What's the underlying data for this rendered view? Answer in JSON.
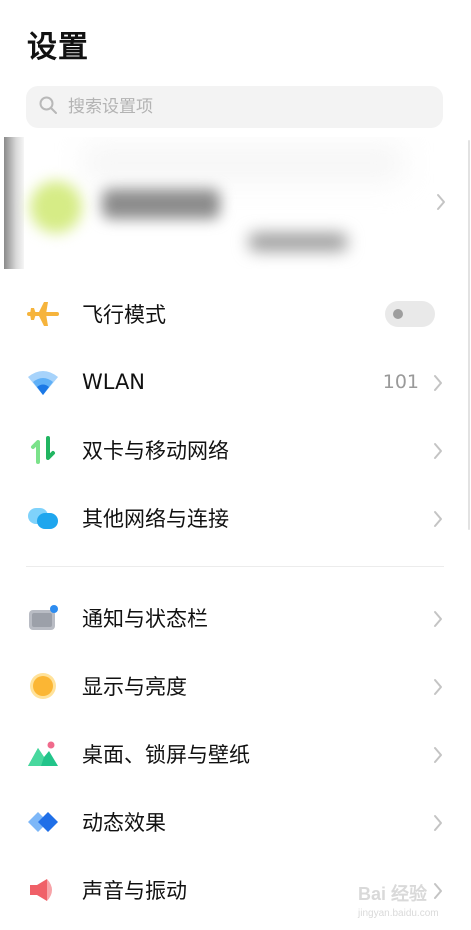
{
  "page": {
    "title": "设置"
  },
  "search": {
    "placeholder": "搜索设置项"
  },
  "sections": [
    {
      "items": [
        {
          "label": "飞行模式",
          "icon": "airplane-icon",
          "control": "toggle",
          "toggle_on": false
        },
        {
          "label": "WLAN",
          "icon": "wifi-icon",
          "value": "101"
        },
        {
          "label": "双卡与移动网络",
          "icon": "dual-sim-icon"
        },
        {
          "label": "其他网络与连接",
          "icon": "connection-icon"
        }
      ]
    },
    {
      "items": [
        {
          "label": "通知与状态栏",
          "icon": "notification-icon"
        },
        {
          "label": "显示与亮度",
          "icon": "brightness-icon"
        },
        {
          "label": "桌面、锁屏与壁纸",
          "icon": "wallpaper-icon"
        },
        {
          "label": "动态效果",
          "icon": "animation-icon"
        },
        {
          "label": "声音与振动",
          "icon": "sound-icon"
        }
      ]
    }
  ],
  "watermark": {
    "text": "Bai 经验",
    "sub": "jingyan.baidu.com"
  },
  "colors": {
    "airplane": "#f6b43c",
    "wifi": "#2a8cf0",
    "sim_green": "#2fc86d",
    "connection": "#31b4f5",
    "brightness": "#fbb634",
    "wallpaper": "#22c48a",
    "animation": "#2a7df0",
    "sound": "#f06068"
  }
}
